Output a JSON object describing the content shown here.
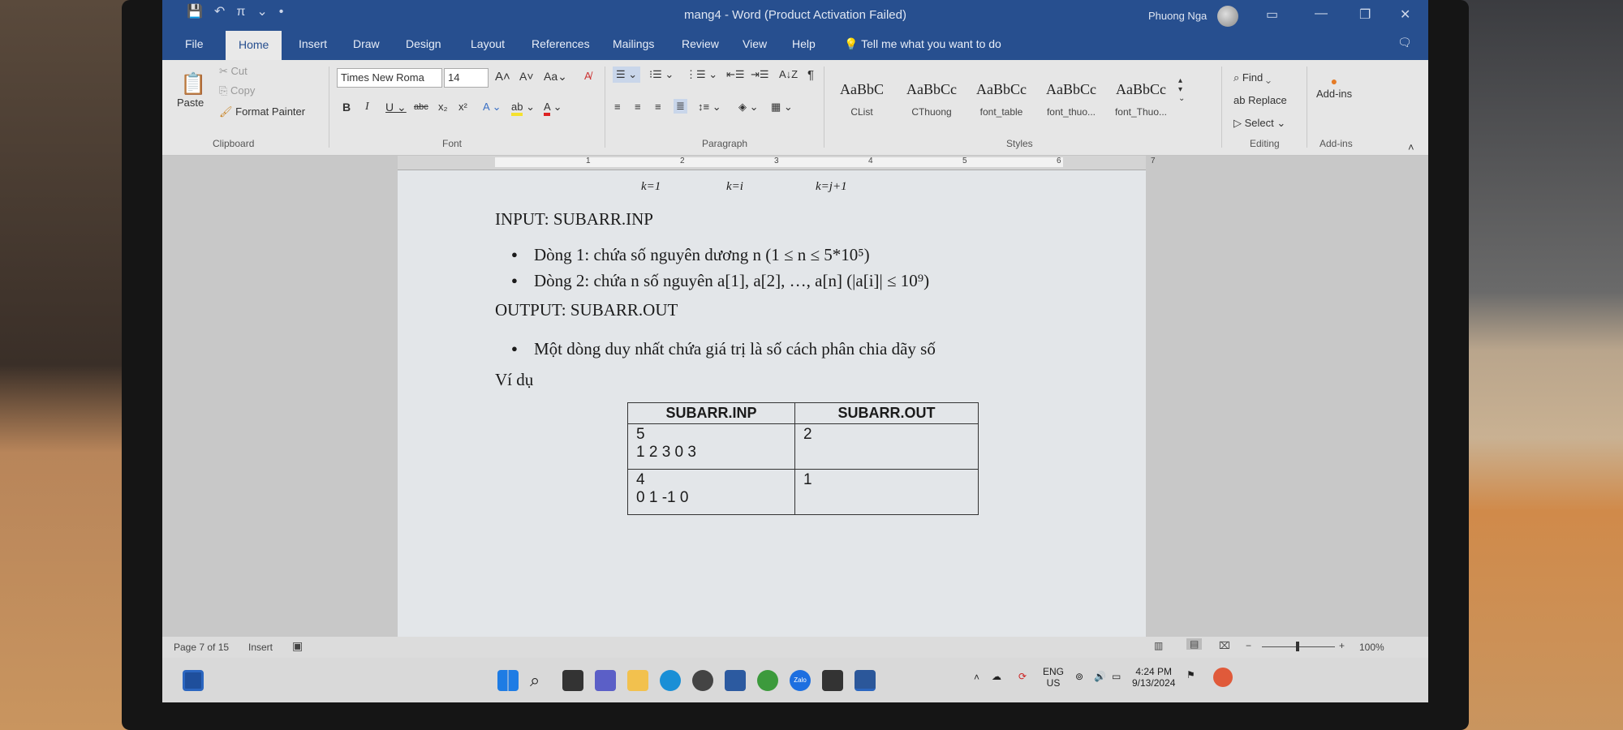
{
  "window": {
    "title": "mang4  -  Word (Product Activation Failed)",
    "user": "Phuong Nga",
    "qat_items": [
      "💾",
      "↶",
      "π",
      "⌄",
      "•"
    ]
  },
  "tabs": [
    "File",
    "Home",
    "Insert",
    "Draw",
    "Design",
    "Layout",
    "References",
    "Mailings",
    "Review",
    "View",
    "Help"
  ],
  "tell_me": "Tell me what you want to do",
  "ribbon": {
    "clipboard": {
      "paste": "Paste",
      "cut": "Cut",
      "copy": "Copy",
      "format_painter": "Format Painter",
      "label": "Clipboard"
    },
    "font": {
      "name": "Times New Roma",
      "size": "14",
      "label": "Font"
    },
    "paragraph": {
      "label": "Paragraph"
    },
    "styles": {
      "label": "Styles",
      "items": [
        {
          "sample": "AaBbC",
          "name": "CList"
        },
        {
          "sample": "AaBbCc",
          "name": "CThuong"
        },
        {
          "sample": "AaBbCc",
          "name": "font_table"
        },
        {
          "sample": "AaBbCc",
          "name": "font_thuo..."
        },
        {
          "sample": "AaBbCc",
          "name": "font_Thuo..."
        }
      ]
    },
    "editing": {
      "find": "Find",
      "replace": "Replace",
      "select": "Select",
      "label": "Editing"
    },
    "addins": {
      "button": "Add-ins",
      "label": "Add-ins"
    }
  },
  "ruler_numbers": [
    "1",
    "2",
    "3",
    "4",
    "5",
    "6",
    "7"
  ],
  "document": {
    "sum_subscripts": [
      "k=1",
      "k=i",
      "k=j+1"
    ],
    "input_heading": "INPUT: SUBARR.INP",
    "input_bullets": [
      "Dòng 1: chứa số nguyên dương n (1 ≤ n ≤ 5*10⁵)",
      "Dòng 2: chứa n số nguyên a[1], a[2], …, a[n] (|a[i]| ≤ 10⁹)"
    ],
    "output_heading": "OUTPUT: SUBARR.OUT",
    "output_bullets": [
      "Một dòng duy nhất chứa giá trị là số cách phân chia dãy số"
    ],
    "example_label": "Ví dụ",
    "table": {
      "headers": [
        "SUBARR.INP",
        "SUBARR.OUT"
      ],
      "rows": [
        {
          "inp_line1": "5",
          "inp_line2": "1 2 3 0 3",
          "out": "2"
        },
        {
          "inp_line1": "4",
          "inp_line2": "0 1 -1 0",
          "out": "1"
        }
      ]
    }
  },
  "status": {
    "page": "Page 7 of 15",
    "mode": "Insert",
    "zoom": "100%"
  },
  "taskbar": {
    "lang": "ENG",
    "region": "US",
    "time": "4:24 PM",
    "date": "9/13/2024",
    "zalo": "Zalo"
  },
  "colors": {
    "title_bar": "#274f8f",
    "ribbon": "#e6e6e6",
    "page": "#e3e6e9"
  }
}
